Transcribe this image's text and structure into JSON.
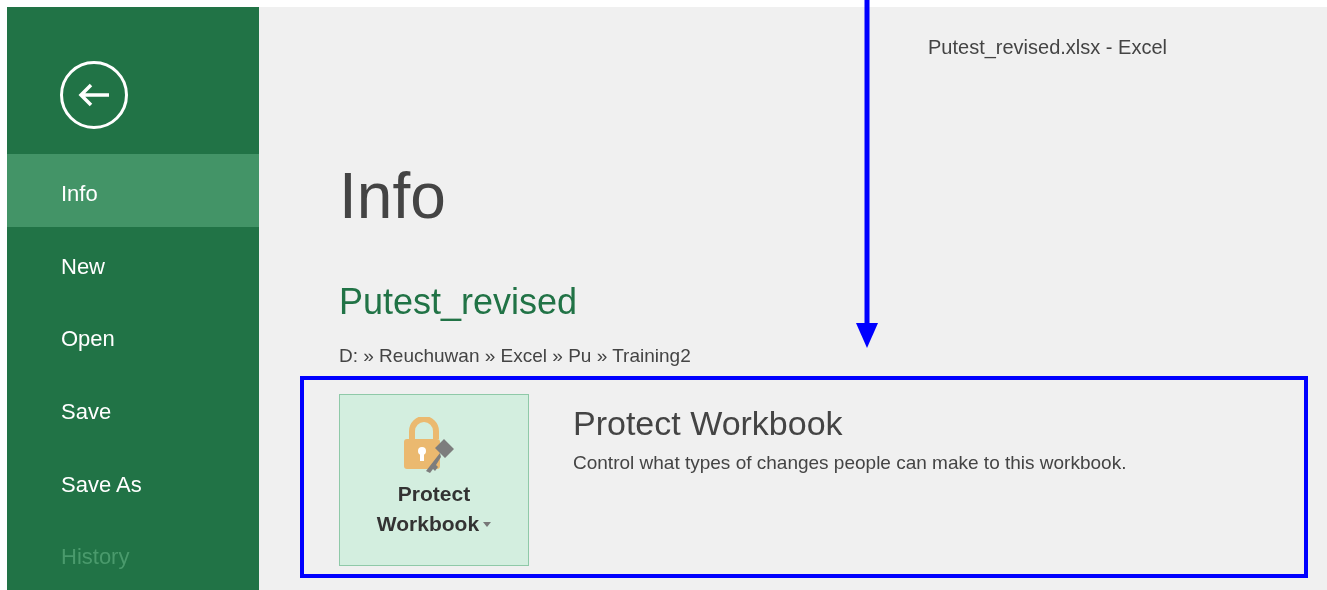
{
  "window": {
    "title": "Putest_revised.xlsx - Excel"
  },
  "sidebar": {
    "items": [
      {
        "label": "Info",
        "selected": true,
        "disabled": false
      },
      {
        "label": "New",
        "selected": false,
        "disabled": false
      },
      {
        "label": "Open",
        "selected": false,
        "disabled": false
      },
      {
        "label": "Save",
        "selected": false,
        "disabled": false
      },
      {
        "label": "Save As",
        "selected": false,
        "disabled": false
      },
      {
        "label": "History",
        "selected": false,
        "disabled": true
      }
    ]
  },
  "page_title": "Info",
  "file_name": "Putest_revised",
  "path": "D: » Reuchuwan » Excel » Pu » Training2",
  "protect": {
    "button_label_1": "Protect",
    "button_label_2": "Workbook",
    "heading": "Protect Workbook",
    "description": "Control what types of changes people can make to this workbook."
  }
}
